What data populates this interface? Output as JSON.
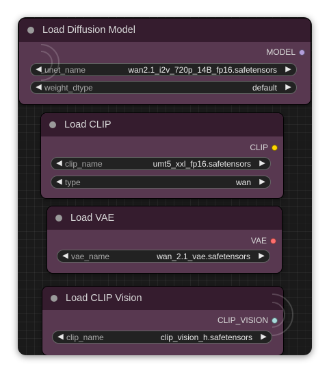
{
  "colors": {
    "node_body": "#583850",
    "node_header": "#351c2e",
    "model_slot": "#b39ddb",
    "clip_slot": "#ffd500",
    "vae_slot": "#ff6e6e",
    "clip_vision_slot": "#a8dadc"
  },
  "nodes": {
    "load_diffusion_model": {
      "title": "Load Diffusion Model",
      "output": "MODEL",
      "widgets": [
        {
          "label": "unet_name",
          "value": "wan2.1_i2v_720p_14B_fp16.safetensors"
        },
        {
          "label": "weight_dtype",
          "value": "default"
        }
      ]
    },
    "load_clip": {
      "title": "Load CLIP",
      "output": "CLIP",
      "widgets": [
        {
          "label": "clip_name",
          "value": "umt5_xxl_fp16.safetensors"
        },
        {
          "label": "type",
          "value": "wan"
        }
      ]
    },
    "load_vae": {
      "title": "Load VAE",
      "output": "VAE",
      "widgets": [
        {
          "label": "vae_name",
          "value": "wan_2.1_vae.safetensors"
        }
      ]
    },
    "load_clip_vision": {
      "title": "Load CLIP Vision",
      "output": "CLIP_VISION",
      "widgets": [
        {
          "label": "clip_name",
          "value": "clip_vision_h.safetensors"
        }
      ]
    }
  }
}
